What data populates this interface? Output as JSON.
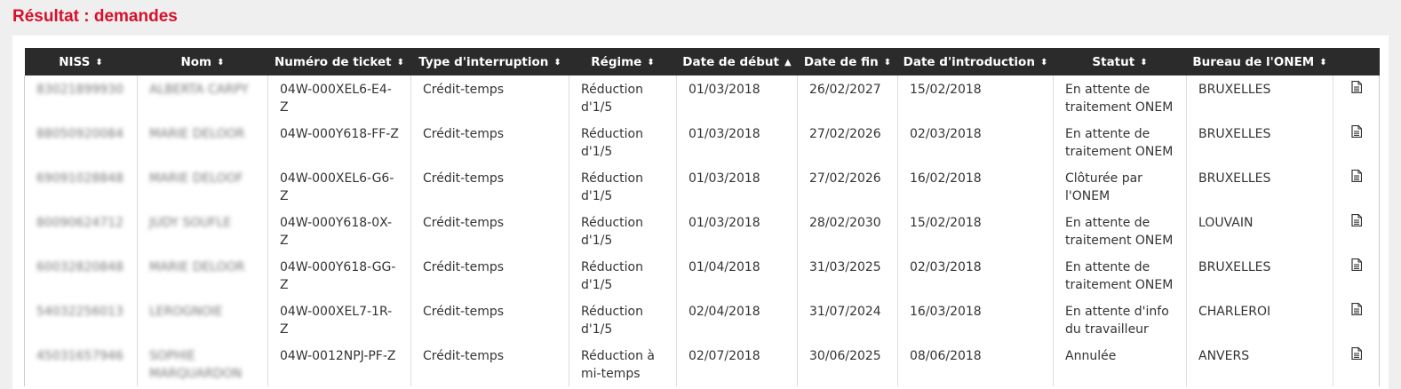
{
  "page": {
    "title": "Résultat : demandes"
  },
  "table": {
    "columns": [
      {
        "key": "niss",
        "label": "NISS",
        "sort": "⬍"
      },
      {
        "key": "nom",
        "label": "Nom",
        "sort": "⬍"
      },
      {
        "key": "ticket",
        "label": "Numéro de ticket",
        "sort": "⬍"
      },
      {
        "key": "type",
        "label": "Type d'interruption",
        "sort": "⬍"
      },
      {
        "key": "regime",
        "label": "Régime",
        "sort": "⬍"
      },
      {
        "key": "debut",
        "label": "Date de début",
        "sort": "▲"
      },
      {
        "key": "fin",
        "label": "Date de fin",
        "sort": "⬍"
      },
      {
        "key": "intro",
        "label": "Date d'introduction",
        "sort": "⬍"
      },
      {
        "key": "statut",
        "label": "Statut",
        "sort": "⬍"
      },
      {
        "key": "bureau",
        "label": "Bureau de l'ONEM",
        "sort": "⬍"
      },
      {
        "key": "doc",
        "label": "",
        "sort": ""
      }
    ],
    "rows": [
      {
        "niss": "83021899930",
        "nom": "ALBERTA CARPY",
        "ticket": "04W-000XEL6-E4-Z",
        "type": "Crédit-temps",
        "regime": "Réduction d'1/5",
        "debut": "01/03/2018",
        "fin": "26/02/2027",
        "intro": "15/02/2018",
        "statut": "En attente de traitement ONEM",
        "bureau": "BRUXELLES"
      },
      {
        "niss": "88050920084",
        "nom": "MARIE DELOOR",
        "ticket": "04W-000Y618-FF-Z",
        "type": "Crédit-temps",
        "regime": "Réduction d'1/5",
        "debut": "01/03/2018",
        "fin": "27/02/2026",
        "intro": "02/03/2018",
        "statut": "En attente de traitement ONEM",
        "bureau": "BRUXELLES"
      },
      {
        "niss": "69091028848",
        "nom": "MARIE DELOOF",
        "ticket": "04W-000XEL6-G6-Z",
        "type": "Crédit-temps",
        "regime": "Réduction d'1/5",
        "debut": "01/03/2018",
        "fin": "27/02/2026",
        "intro": "16/02/2018",
        "statut": "Clôturée par l'ONEM",
        "bureau": "BRUXELLES"
      },
      {
        "niss": "80090624712",
        "nom": "JUDY SOUFLE",
        "ticket": "04W-000Y618-0X-Z",
        "type": "Crédit-temps",
        "regime": "Réduction d'1/5",
        "debut": "01/03/2018",
        "fin": "28/02/2030",
        "intro": "15/02/2018",
        "statut": "En attente de traitement ONEM",
        "bureau": "LOUVAIN"
      },
      {
        "niss": "60032820848",
        "nom": "MARIE DELOOR",
        "ticket": "04W-000Y618-GG-Z",
        "type": "Crédit-temps",
        "regime": "Réduction d'1/5",
        "debut": "01/04/2018",
        "fin": "31/03/2025",
        "intro": "02/03/2018",
        "statut": "En attente de traitement ONEM",
        "bureau": "BRUXELLES"
      },
      {
        "niss": "54032256013",
        "nom": "LEROGNOIE",
        "ticket": "04W-000XEL7-1R-Z",
        "type": "Crédit-temps",
        "regime": "Réduction d'1/5",
        "debut": "02/04/2018",
        "fin": "31/07/2024",
        "intro": "16/03/2018",
        "statut": "En attente d'info du travailleur",
        "bureau": "CHARLEROI"
      },
      {
        "niss": "45031657946",
        "nom": "SOPHIE MARQUARDON",
        "ticket": "04W-0012NPJ-PF-Z",
        "type": "Crédit-temps",
        "regime": "Réduction à mi-temps",
        "debut": "02/07/2018",
        "fin": "30/06/2025",
        "intro": "08/06/2018",
        "statut": "Annulée",
        "bureau": "ANVERS"
      }
    ]
  },
  "icons": {
    "document": "document-icon"
  }
}
